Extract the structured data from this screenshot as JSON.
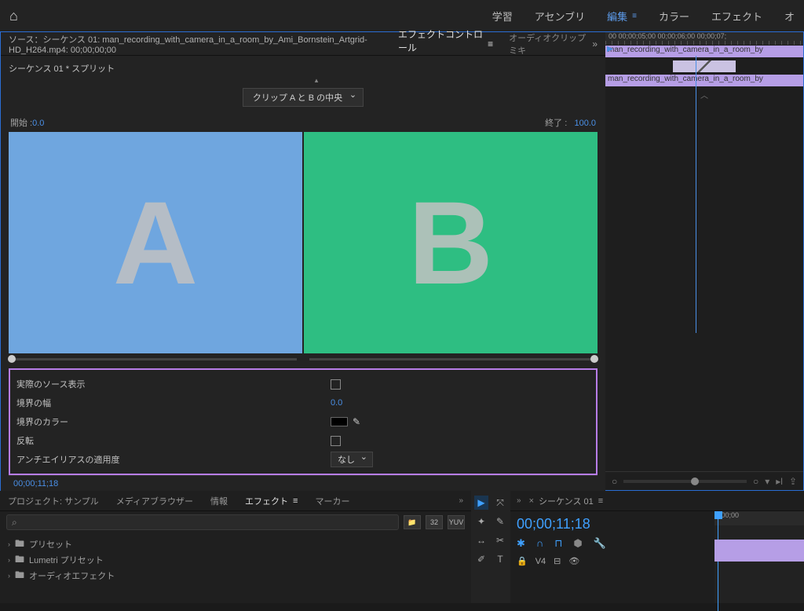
{
  "workspace": {
    "tabs": [
      "学習",
      "アセンブリ",
      "編集",
      "カラー",
      "エフェクト",
      "オ"
    ],
    "active_index": 2
  },
  "source_tab": "ソース：シーケンス 01: man_recording_with_camera_in_a_room_by_Ami_Bornstein_Artgrid-HD_H264.mp4: 00;00;00;00",
  "effect_controls_tab": "エフェクトコントロール",
  "audio_clip_tab": "オーディオクリップミキ",
  "breadcrumb": "シーケンス 01 * スプリット",
  "center_dropdown": "クリップ A と B の中央",
  "start_label": "開始 :",
  "start_value": "0.0",
  "end_label": "終了 :",
  "end_value": "100.0",
  "preview": {
    "a_letter": "A",
    "b_letter": "B"
  },
  "props": {
    "actual_source": {
      "label": "実際のソース表示"
    },
    "border_width": {
      "label": "境界の幅",
      "value": "0.0"
    },
    "border_color": {
      "label": "境界のカラー"
    },
    "reverse": {
      "label": "反転"
    },
    "antialias": {
      "label": "アンチエイリアスの適用度",
      "value": "なし"
    }
  },
  "timecode_bottom": "00;00;11;18",
  "timeline_ruler": "00 00;00;05;00 00;00;06;00 00;00;07;",
  "clip_name": "man_recording_with_camera_in_a_room_by",
  "bottom_tabs": {
    "project": "プロジェクト: サンプル",
    "media": "メディアブラウザー",
    "info": "情報",
    "effects": "エフェクト",
    "markers": "マーカー"
  },
  "search_placeholder": "⌕",
  "btn_icons": [
    "📁",
    "32",
    "YUV"
  ],
  "tree": {
    "presets": "プリセット",
    "lumetri": "Lumetri プリセット",
    "audio_fx": "オーディオエフェクト"
  },
  "sequence_tab": "シーケンス 01",
  "sequence_tc": "00;00;11;18",
  "track_label": "V4",
  "seq_ruler": ";00;00"
}
